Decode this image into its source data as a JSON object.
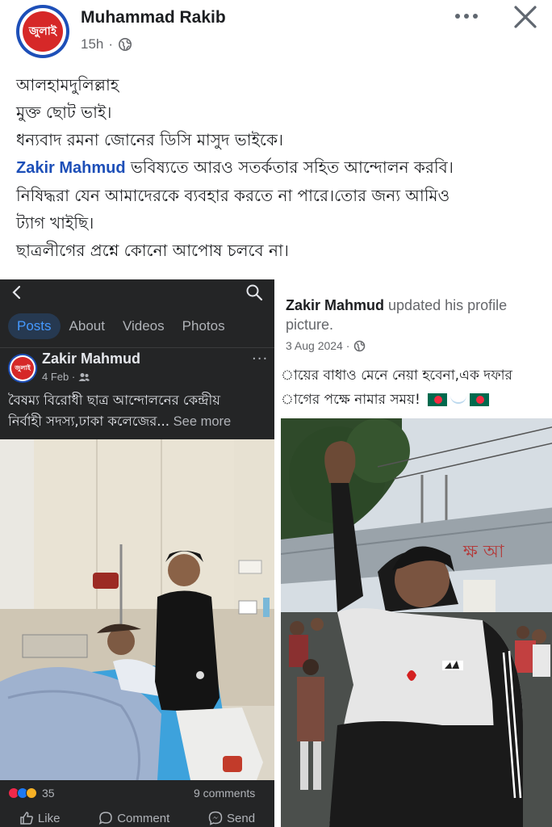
{
  "post": {
    "author": "Muhammad Rakib",
    "avatar_text": "জুলাই",
    "time": "15h",
    "dot": "·",
    "text_lines": [
      "আলহামদুলিল্লাহ",
      "মুক্ত ছোট ভাই।",
      "ধন্যবাদ রমনা জোনের ডিসি মাসুদ ভাইকে।"
    ],
    "mention": "Zakir Mahmud",
    "mention_rest": " ভবিষ্যতে আরও সতর্কতার সহিত আন্দোলন করবি।",
    "text_lines_after": [
      "নিষিদ্ধরা যেন আমাদেরকে ব্যবহার করতে না পারে।তোর জন্য আমিও",
      "ট্যাগ খাইছি।",
      "ছাত্রলীগের প্রশ্নে কোনো আপোষ চলবে না।"
    ]
  },
  "left_screenshot": {
    "tabs": [
      {
        "label": "Posts",
        "active": true
      },
      {
        "label": "About",
        "active": false
      },
      {
        "label": "Videos",
        "active": false
      },
      {
        "label": "Photos",
        "active": false
      }
    ],
    "author": "Zakir Mahmud",
    "avatar_text": "জুলাই",
    "date": "4 Feb ·",
    "more": "···",
    "text_line1": "বৈষম্য বিরোধী ছাত্র আন্দোলনের কেন্দ্রীয়",
    "text_line2": "নির্বাহী সদস্য,ঢাকা কলেজের...",
    "see_more": " See more",
    "reaction_count": "35",
    "comments": "9 comments",
    "actions": {
      "like": "Like",
      "comment": "Comment",
      "send": "Send"
    }
  },
  "right_screenshot": {
    "author": "Zakir Mahmud",
    "updated": " updated his profile picture.",
    "date": "3 Aug 2024 ·",
    "text_line1": "ায়ের বাধাও মেনে নেয়া হবেনা,এক দফার",
    "text_line2": "াগের পক্ষে নামার সময়!",
    "banner_text": "ক্ষ আ"
  },
  "colors": {
    "facebook_blue": "#1d4fb8",
    "dark_bg": "#242526",
    "active_tab_text": "#4599ff",
    "badge_red": "#d62828"
  }
}
